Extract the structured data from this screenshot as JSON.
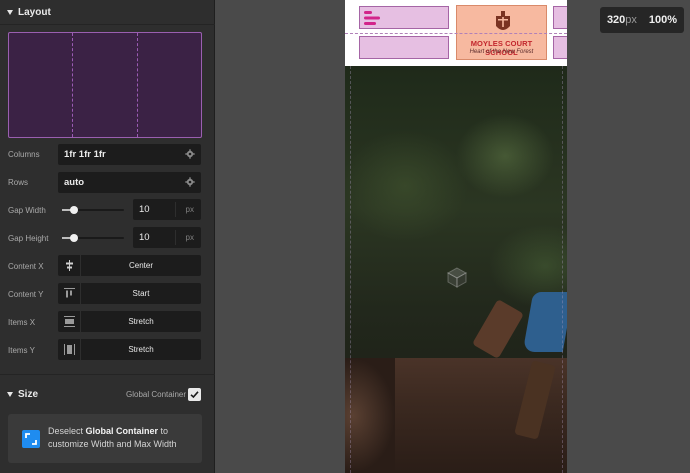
{
  "layout_section": {
    "title": "Layout",
    "columns": {
      "label": "Columns",
      "value": "1fr 1fr 1fr"
    },
    "rows": {
      "label": "Rows",
      "value": "auto"
    },
    "gap_width": {
      "label": "Gap Width",
      "value": "10",
      "unit": "px",
      "slider_level": 0.2
    },
    "gap_height": {
      "label": "Gap Height",
      "value": "10",
      "unit": "px",
      "slider_level": 0.2
    },
    "content_x": {
      "label": "Content X",
      "value": "Center"
    },
    "content_y": {
      "label": "Content Y",
      "value": "Start"
    },
    "items_x": {
      "label": "Items X",
      "value": "Stretch"
    },
    "items_y": {
      "label": "Items Y",
      "value": "Stretch"
    }
  },
  "size_section": {
    "title": "Size",
    "global_container_label": "Global Container",
    "global_container_checked": true,
    "info": {
      "prefix": "Deselect ",
      "bold": "Global Container",
      "suffix": " to customize Width and Max Width"
    }
  },
  "viewport": {
    "width_value": "320",
    "width_unit": "px",
    "zoom": "100%"
  },
  "preview": {
    "logo_title": "MOYLES COURT SCHOOL",
    "logo_tagline": "Heart of the New Forest"
  },
  "colors": {
    "grid_fill": "#3b2245",
    "grid_border": "#9a5fb0",
    "info_icon": "#1f8cf0",
    "logo_red": "#c2272d",
    "header_cell": "#e6bfe2"
  }
}
